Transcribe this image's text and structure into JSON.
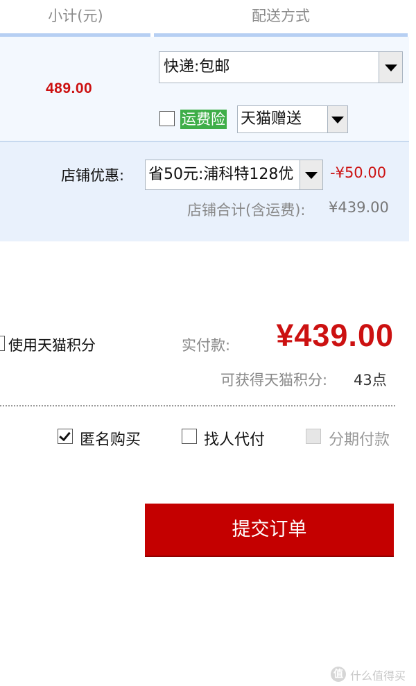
{
  "header": {
    "subtotal_label": "小计(元)",
    "shipping_label": "配送方式"
  },
  "item": {
    "subtotal": "489.00",
    "shipping_select": "快递:包邮",
    "freight_insurance_label": "运费险",
    "freight_insurance_checked": false,
    "freight_insurance_option": "天猫赠送"
  },
  "shop": {
    "discount_label": "店铺优惠:",
    "discount_select": "省50元:浦科特128优",
    "discount_amount": "-¥50.00",
    "total_label": "店铺合计(含运费):",
    "total_value": "¥439.00"
  },
  "summary": {
    "use_points_label": "使用天猫积分",
    "use_points_checked": false,
    "pay_label": "实付款:",
    "pay_amount": "¥439.00",
    "points_label": "可获得天猫积分:",
    "points_value": "43点"
  },
  "options": {
    "anonymous_label": "匿名购买",
    "anonymous_checked": true,
    "pay_for_me_label": "找人代付",
    "pay_for_me_checked": false,
    "installment_label": "分期付款",
    "installment_enabled": false
  },
  "actions": {
    "submit_label": "提交订单"
  },
  "watermark": {
    "glyph": "值",
    "text": "什么值得买"
  },
  "colors": {
    "accent_red": "#c40000",
    "price_red": "#cc1111",
    "header_blue": "#b6cff3",
    "band_blue": "#e9f1fc",
    "insurance_green": "#3fae49"
  }
}
